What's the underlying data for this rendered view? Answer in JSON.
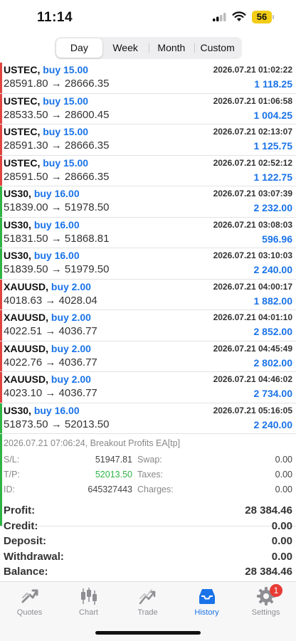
{
  "status_bar": {
    "time": "11:14",
    "battery": "56"
  },
  "periods": [
    "Day",
    "Week",
    "Month",
    "Custom"
  ],
  "selected_period": "Day",
  "trades": [
    {
      "symbol": "USTEC,",
      "action": "buy 15.00",
      "datetime": "2026.07.21 01:02:22",
      "prices": "28591.80 → 28666.35",
      "profit": "1 118.25",
      "side": "red"
    },
    {
      "symbol": "USTEC,",
      "action": "buy 15.00",
      "datetime": "2026.07.21 01:06:58",
      "prices": "28533.50 → 28600.45",
      "profit": "1 004.25",
      "side": "red"
    },
    {
      "symbol": "USTEC,",
      "action": "buy 15.00",
      "datetime": "2026.07.21 02:13:07",
      "prices": "28591.30 → 28666.35",
      "profit": "1 125.75",
      "side": "red"
    },
    {
      "symbol": "USTEC,",
      "action": "buy 15.00",
      "datetime": "2026.07.21 02:52:12",
      "prices": "28591.50 → 28666.35",
      "profit": "1 122.75",
      "side": "red"
    },
    {
      "symbol": "US30,",
      "action": "buy 16.00",
      "datetime": "2026.07.21 03:07:39",
      "prices": "51839.00 → 51978.50",
      "profit": "2 232.00",
      "side": "green"
    },
    {
      "symbol": "US30,",
      "action": "buy 16.00",
      "datetime": "2026.07.21 03:08:03",
      "prices": "51831.50 → 51868.81",
      "profit": "596.96",
      "side": "green"
    },
    {
      "symbol": "US30,",
      "action": "buy 16.00",
      "datetime": "2026.07.21 03:10:03",
      "prices": "51839.50 → 51979.50",
      "profit": "2 240.00",
      "side": "green"
    },
    {
      "symbol": "XAUUSD,",
      "action": "buy 2.00",
      "datetime": "2026.07.21 04:00:17",
      "prices": "4018.63 → 4028.04",
      "profit": "1 882.00",
      "side": "red"
    },
    {
      "symbol": "XAUUSD,",
      "action": "buy 2.00",
      "datetime": "2026.07.21 04:01:10",
      "prices": "4022.51 → 4036.77",
      "profit": "2 852.00",
      "side": "red"
    },
    {
      "symbol": "XAUUSD,",
      "action": "buy 2.00",
      "datetime": "2026.07.21 04:45:49",
      "prices": "4022.76 → 4036.77",
      "profit": "2 802.00",
      "side": "red"
    },
    {
      "symbol": "XAUUSD,",
      "action": "buy 2.00",
      "datetime": "2026.07.21 04:46:02",
      "prices": "4023.10 → 4036.77",
      "profit": "2 734.00",
      "side": "red"
    },
    {
      "symbol": "US30,",
      "action": "buy 16.00",
      "datetime": "2026.07.21 05:16:05",
      "prices": "51873.50 → 52013.50",
      "profit": "2 240.00",
      "side": "green"
    }
  ],
  "detail": {
    "closed": "2026.07.21 07:06:24, Breakout Profits EA[tp]",
    "sl_label": "S/L:",
    "sl": "51947.81",
    "tp_label": "T/P:",
    "tp": "52013.50",
    "id_label": "ID:",
    "id": "645327443",
    "swap_label": "Swap:",
    "swap": "0.00",
    "taxes_label": "Taxes:",
    "taxes": "0.00",
    "charges_label": "Charges:",
    "charges": "0.00"
  },
  "summary": [
    {
      "label": "Profit:",
      "value": "28 384.46"
    },
    {
      "label": "Credit:",
      "value": "0.00"
    },
    {
      "label": "Deposit:",
      "value": "0.00"
    },
    {
      "label": "Withdrawal:",
      "value": "0.00"
    },
    {
      "label": "Balance:",
      "value": "28 384.46"
    }
  ],
  "tabs": [
    {
      "label": "Quotes",
      "icon": "quotes-icon"
    },
    {
      "label": "Chart",
      "icon": "candlestick-icon"
    },
    {
      "label": "Trade",
      "icon": "trade-icon"
    },
    {
      "label": "History",
      "icon": "inbox-icon",
      "active": true
    },
    {
      "label": "Settings",
      "icon": "gear-icon",
      "badge": "1"
    }
  ],
  "colors": {
    "accent": "#1a73e8",
    "buy_bar_red": "#e0443e",
    "buy_bar_green": "#2fb344",
    "tp_green": "#2fb344",
    "badge": "#e83b35"
  }
}
